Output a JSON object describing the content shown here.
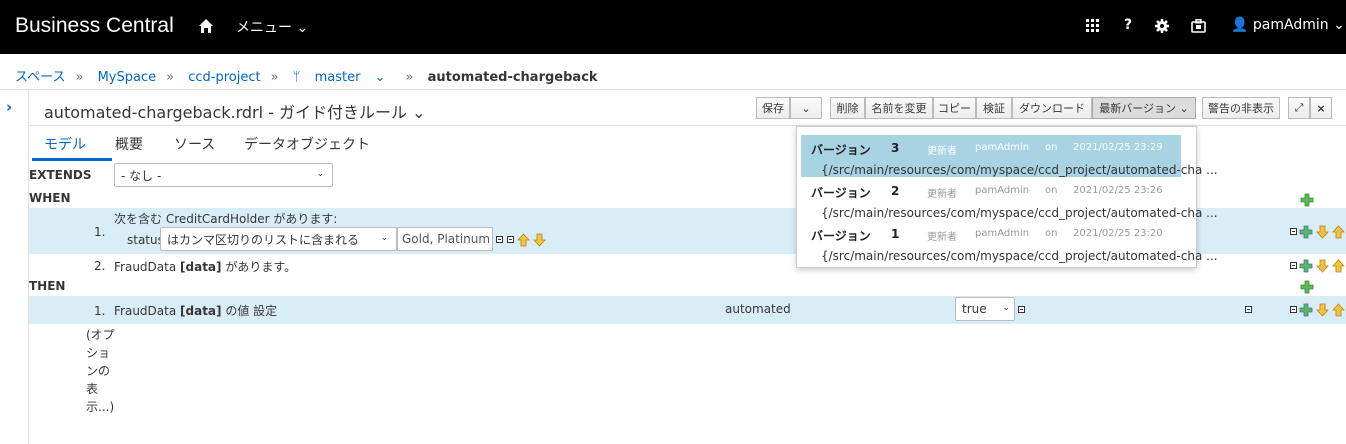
{
  "header": {
    "brand": "Business Central",
    "menu_label": "メニュー",
    "help_label": "?",
    "user_label": "pamAdmin"
  },
  "breadcrumb": {
    "spaces": "スペース",
    "space": "MySpace",
    "project": "ccd-project",
    "branch": "master",
    "asset": "automated-chargeback"
  },
  "editor": {
    "title": "automated-chargeback.rdrl - ガイド付きルール",
    "toolbar": {
      "save": "保存",
      "delete": "削除",
      "rename": "名前を変更",
      "copy": "コピー",
      "validate": "検証",
      "download": "ダウンロード",
      "latest_version": "最新バージョン",
      "hide_alerts": "警告の非表示"
    },
    "tabs": [
      "モデル",
      "概要",
      "ソース",
      "データオブジェクト"
    ]
  },
  "rule": {
    "extends_label": "EXTENDS",
    "extends_value": "- なし -",
    "when_label": "WHEN",
    "then_label": "THEN",
    "when1_num": "1.",
    "when1_text": "次を含む CreditCardHolder があります:",
    "when1_field": "status",
    "when1_operator": "はカンマ区切りのリストに含まれる",
    "when1_value": "Gold, Platinum",
    "when2_num": "2.",
    "when2_pre": "FraudData ",
    "when2_bold": "[data]",
    "when2_post": " があります。",
    "then1_num": "1.",
    "then1_pre": "FraudData ",
    "then1_bold": "[data]",
    "then1_post": " の値 設定",
    "then1_field": "automated",
    "then1_value": "true",
    "options_text": "(オプションの表示...)"
  },
  "versions": [
    {
      "label": "バージョン",
      "num": "3",
      "by_label": "更新者",
      "user": "pamAdmin",
      "on": "on",
      "date": "2021/02/25 23:29",
      "path": "{/src/main/resources/com/myspace/ccd_project/automated-cha ..."
    },
    {
      "label": "バージョン",
      "num": "2",
      "by_label": "更新者",
      "user": "pamAdmin",
      "on": "on",
      "date": "2021/02/25 23:26",
      "path": "{/src/main/resources/com/myspace/ccd_project/automated-cha ..."
    },
    {
      "label": "バージョン",
      "num": "1",
      "by_label": "更新者",
      "user": "pamAdmin",
      "on": "on",
      "date": "2021/02/25 23:20",
      "path": "{/src/main/resources/com/myspace/ccd_project/automated-cha ..."
    }
  ],
  "colors": {
    "header_bg": "#000000",
    "link": "#0066cc",
    "row_bg": "#d9edf7",
    "selected_version": "#a7d3e3"
  }
}
